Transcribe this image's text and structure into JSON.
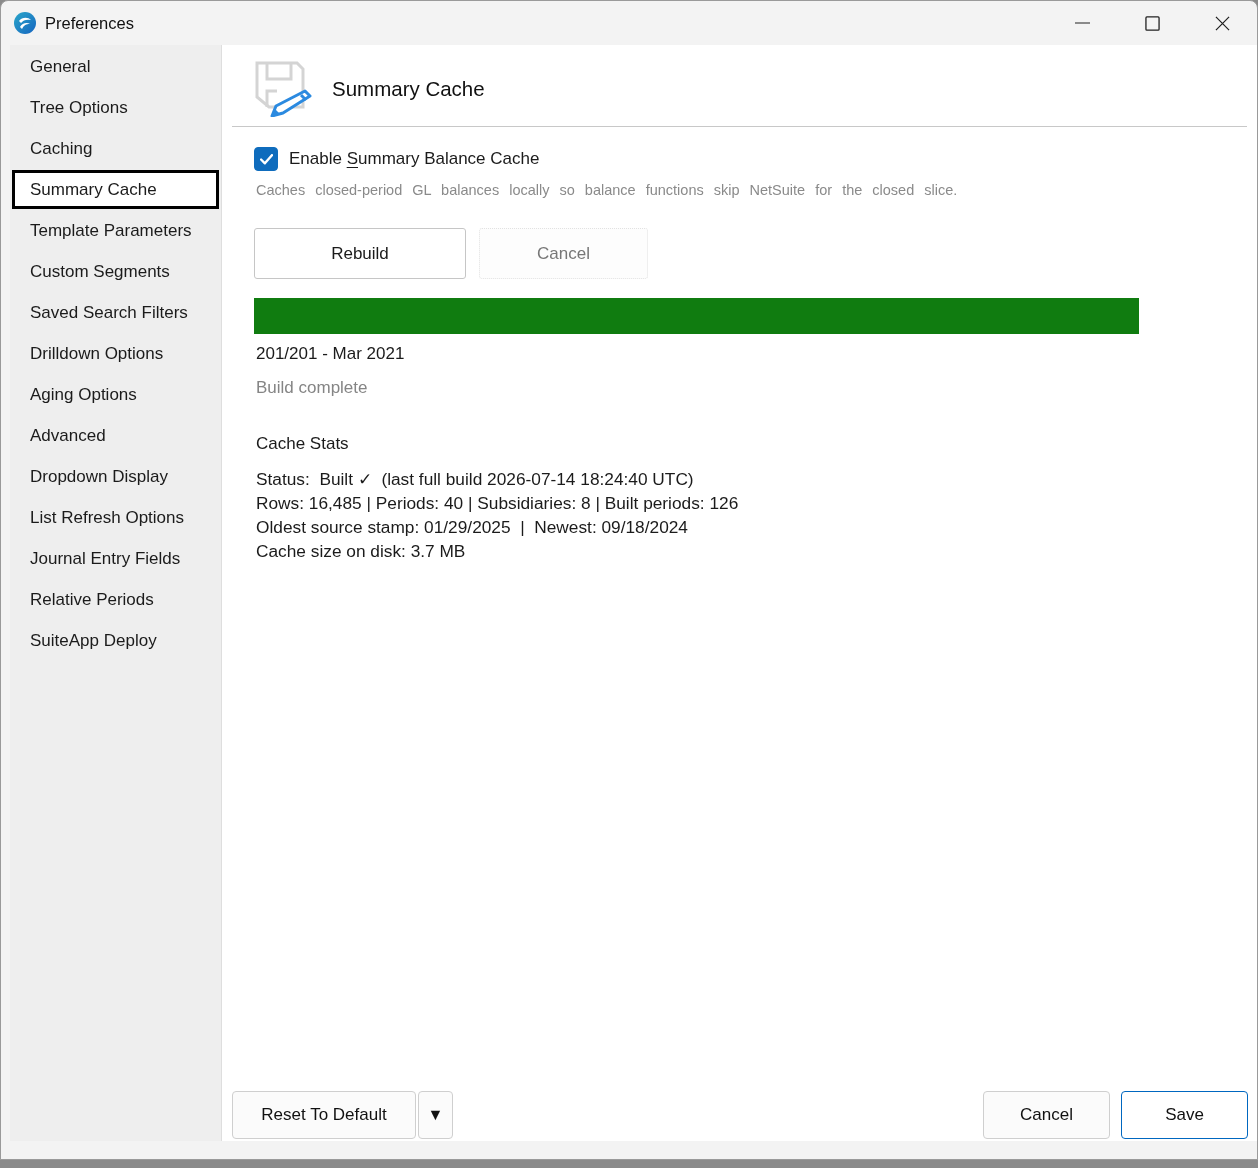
{
  "window": {
    "title": "Preferences"
  },
  "sidebar": {
    "items": [
      {
        "label": "General",
        "selected": false
      },
      {
        "label": "Tree Options",
        "selected": false
      },
      {
        "label": "Caching",
        "selected": false
      },
      {
        "label": "Summary Cache",
        "selected": true
      },
      {
        "label": "Template Parameters",
        "selected": false
      },
      {
        "label": "Custom Segments",
        "selected": false
      },
      {
        "label": "Saved Search Filters",
        "selected": false
      },
      {
        "label": "Drilldown Options",
        "selected": false
      },
      {
        "label": "Aging Options",
        "selected": false
      },
      {
        "label": "Advanced",
        "selected": false
      },
      {
        "label": "Dropdown Display",
        "selected": false
      },
      {
        "label": "List Refresh Options",
        "selected": false
      },
      {
        "label": "Journal Entry Fields",
        "selected": false
      },
      {
        "label": "Relative Periods",
        "selected": false
      },
      {
        "label": "SuiteApp Deploy",
        "selected": false
      }
    ]
  },
  "header": {
    "title": "Summary Cache"
  },
  "enable_checkbox": {
    "checked": true,
    "label_parts": [
      {
        "text": "Enable ",
        "underlined": false
      },
      {
        "text": "S",
        "underlined": true
      },
      {
        "text": "ummary Balance Cache",
        "underlined": false
      }
    ]
  },
  "description": "Caches closed-period GL balances locally so balance functions skip NetSuite for the closed slice.",
  "actions": [
    {
      "label": "Rebuild",
      "disabled": false
    },
    {
      "label": "Cancel",
      "disabled": true
    }
  ],
  "progress": {
    "level": 1,
    "reading": "201/201 - Mar 2021",
    "status": "Build complete"
  },
  "cache_stats": {
    "title": "Cache Stats",
    "lines": [
      "Status:  Built ✓  (last full build 2026-07-14 18:24:40 UTC)",
      "Rows: 16,485 | Periods: 40 | Subsidiaries: 8 | Built periods: 126",
      "Oldest source stamp: 01/29/2025  |  Newest: 09/18/2024",
      "Cache size on disk: 3.7 MB"
    ]
  },
  "footer": {
    "left_buttons": [
      {
        "label": "Reset To Default",
        "kind": "text"
      },
      {
        "label": "▼",
        "kind": "dropdown"
      }
    ],
    "right_buttons": [
      {
        "label": "Cancel",
        "default": false
      },
      {
        "label": "Save",
        "default": true
      }
    ]
  }
}
